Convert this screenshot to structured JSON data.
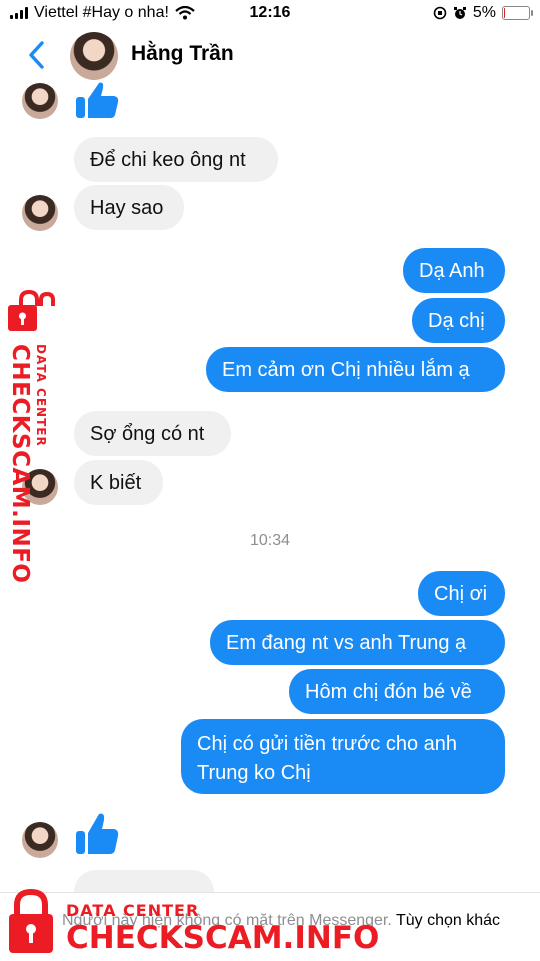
{
  "status_bar": {
    "carrier": "Viettel #Hay o nha!",
    "time": "12:16",
    "battery_text": "5%",
    "battery_level": 0.05
  },
  "header": {
    "contact_name": "Hằng Trần",
    "back_icon": "chevron-left-icon"
  },
  "conversation": {
    "incoming_1": "Để chi keo ông nt",
    "incoming_2": "Hay sao",
    "outgoing_1": "Dạ Anh",
    "outgoing_2": "Dạ chị",
    "outgoing_3": "Em cảm ơn Chị nhiều lắm ạ",
    "incoming_3": "Sợ ổng có nt",
    "incoming_4": "K biết",
    "timestamp": "10:34",
    "outgoing_4": "Chị ơi",
    "outgoing_5": "Em đang nt vs anh Trung ạ",
    "outgoing_6": "Hôm chị đón bé về",
    "outgoing_7_line1": "Chị có gửi tiền trước cho anh",
    "outgoing_7_line2": "Trung ko Chị"
  },
  "footer": {
    "notice": "Người này hiện không có mặt trên Messenger.",
    "link": "Tùy chọn khác"
  },
  "watermark": {
    "sub": "DATA CENTER",
    "main": "CHECKSCAM.INFO"
  },
  "colors": {
    "outgoing_bubble": "#1a8af5",
    "incoming_bubble": "#f0f0f0",
    "accent": "#1a8af5",
    "watermark": "#ec1c24"
  }
}
